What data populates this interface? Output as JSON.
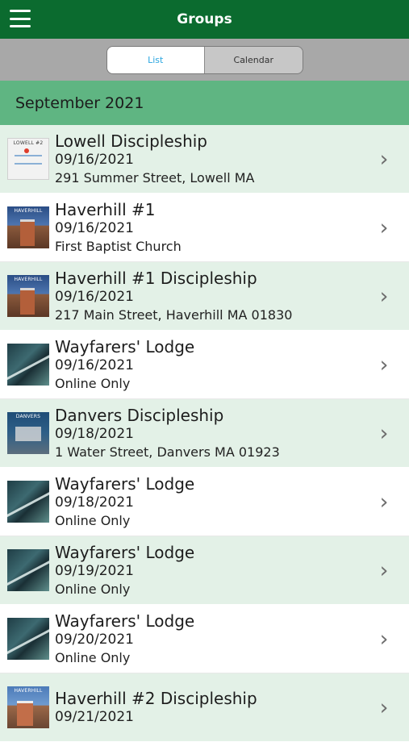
{
  "header": {
    "title": "Groups"
  },
  "segmented": {
    "list_label": "List",
    "calendar_label": "Calendar"
  },
  "month": "September 2021",
  "groups": [
    {
      "name": "Lowell Discipleship",
      "date": "09/16/2021",
      "location": "291 Summer Street, Lowell MA",
      "thumb_icon": "map-thumbnail",
      "badge": "LOWELL #2"
    },
    {
      "name": "Haverhill #1",
      "date": "09/16/2021",
      "location": "First Baptist Church",
      "thumb_icon": "church-thumbnail",
      "badge": "HAVERHILL"
    },
    {
      "name": "Haverhill #1 Discipleship",
      "date": "09/16/2021",
      "location": "217 Main Street, Haverhill MA 01830",
      "thumb_icon": "church-thumbnail",
      "badge": "HAVERHILL"
    },
    {
      "name": "Wayfarers' Lodge",
      "date": "09/16/2021",
      "location": "Online Only",
      "thumb_icon": "water-thumbnail",
      "badge": ""
    },
    {
      "name": "Danvers Discipleship",
      "date": "09/18/2021",
      "location": "1 Water Street, Danvers MA 01923",
      "thumb_icon": "danvers-thumbnail",
      "badge": "DANVERS"
    },
    {
      "name": "Wayfarers' Lodge",
      "date": "09/18/2021",
      "location": "Online Only",
      "thumb_icon": "water-thumbnail",
      "badge": ""
    },
    {
      "name": "Wayfarers' Lodge",
      "date": "09/19/2021",
      "location": "Online Only",
      "thumb_icon": "water-thumbnail",
      "badge": ""
    },
    {
      "name": "Wayfarers' Lodge",
      "date": "09/20/2021",
      "location": "Online Only",
      "thumb_icon": "water-thumbnail",
      "badge": ""
    },
    {
      "name": "Haverhill #2 Discipleship",
      "date": "09/21/2021",
      "location": "",
      "thumb_icon": "church-thumbnail",
      "badge": "HAVERHILL"
    }
  ],
  "colors": {
    "topbar": "#0b6b2f",
    "month_header": "#5fb582",
    "alt_row": "#e3f1e7",
    "segment_active_text": "#2ba6e0"
  }
}
